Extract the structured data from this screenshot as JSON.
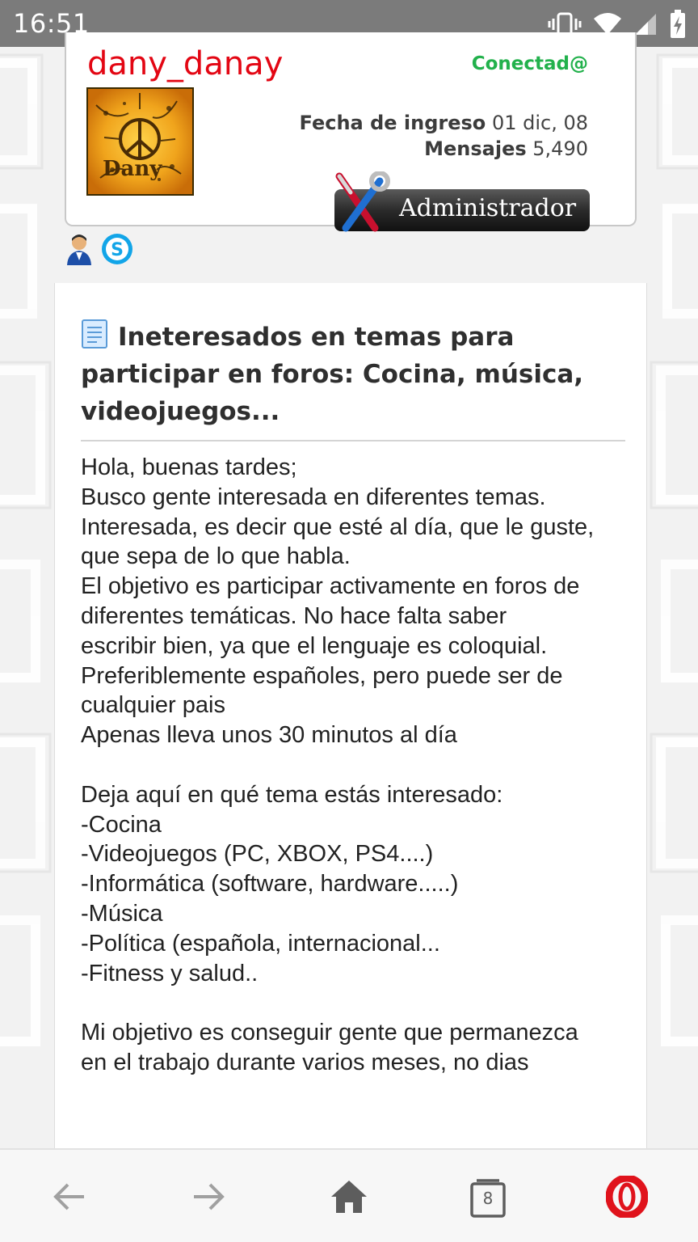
{
  "status_bar": {
    "time": "16:51"
  },
  "profile": {
    "username": "dany_danay",
    "online_status": "Conectad@",
    "avatar_text": "Dany",
    "join_date_label": "Fecha de ingreso",
    "join_date_value": "01 dic, 08",
    "posts_label": "Mensajes",
    "posts_value": "5,490",
    "rank": "Administrador"
  },
  "post": {
    "title": "Ineteresados en temas para participar en foros: Cocina, música, videojuegos...",
    "body_lines": [
      "Hola, buenas tardes;",
      "Busco gente interesada en diferentes temas.",
      "Interesada, es decir que esté al día, que le guste,",
      "que sepa de lo que habla.",
      "El objetivo es participar activamente en foros de",
      "diferentes temáticas. No hace falta saber",
      "escribir bien, ya que el lenguaje es coloquial.",
      "Preferiblemente españoles, pero puede ser de",
      "cualquier pais",
      "Apenas lleva unos 30 minutos al día",
      "",
      "Deja aquí en qué tema estás interesado:",
      "-Cocina",
      "-Videojuegos (PC, XBOX, PS4....)",
      "-Informática (software, hardware.....)",
      "-Música",
      "-Política (española, internacional...",
      "-Fitness y salud..",
      "",
      "Mi objetivo es conseguir gente que permanezca",
      "en el trabajo durante varios meses, no dias"
    ]
  },
  "bottom_nav": {
    "tab_count": "8"
  },
  "colors": {
    "username": "#e30613",
    "online": "#22b14c",
    "status_bar": "#7b7b7b",
    "opera_red": "#e0131c"
  },
  "icons": {
    "status": [
      "vibrate-icon",
      "wifi-icon",
      "cellular-signal-icon",
      "battery-charging-icon"
    ],
    "contact": [
      "profile-icon",
      "skype-icon"
    ],
    "nav": [
      "back-arrow-icon",
      "forward-arrow-icon",
      "home-icon",
      "tabs-icon",
      "opera-menu-icon"
    ]
  }
}
